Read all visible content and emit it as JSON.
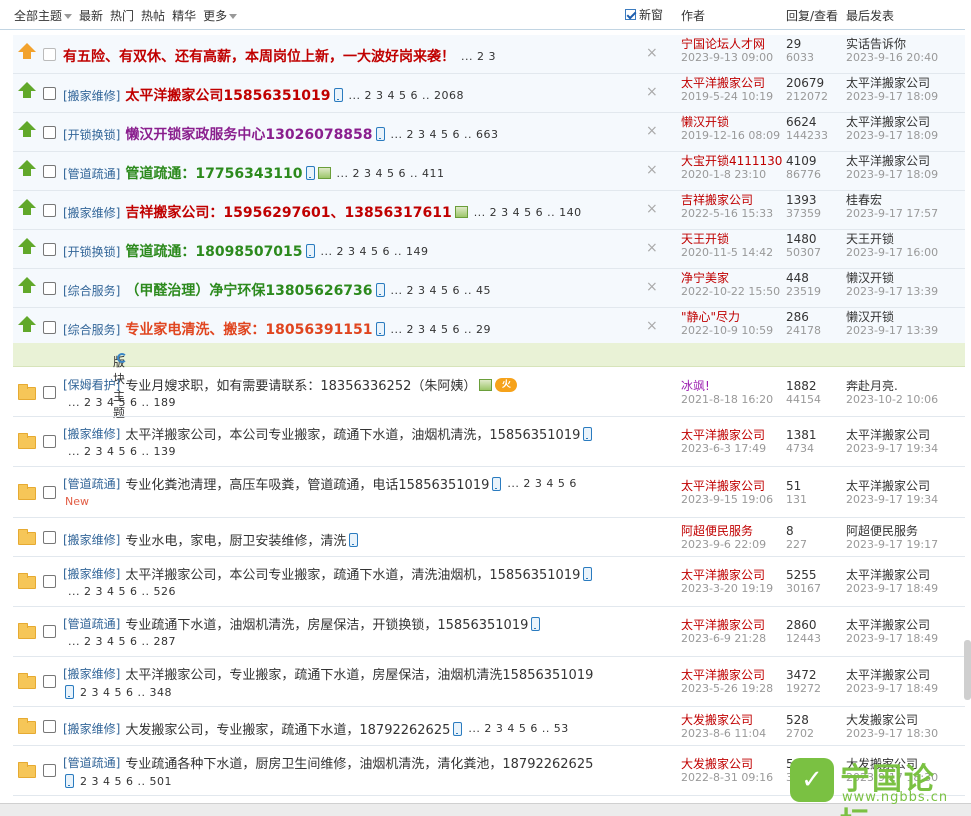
{
  "header": {
    "filters": [
      "全部主题",
      "最新",
      "热门",
      "热帖",
      "精华",
      "更多"
    ],
    "newwin_label": "新窗",
    "col_author": "作者",
    "col_reply": "回复/查看",
    "col_last": "最后发表"
  },
  "sticky": [
    {
      "tag": "",
      "title": "有五险、有双休、还有高薪，本周岗位上新，一大波好岗来袭！",
      "title_color": "#c00000",
      "pages": "... 2  3",
      "author": "宁国论坛人才网",
      "author_color": "#c00000",
      "date": "2023-9-13 09:00",
      "replies": "29",
      "views": "6033",
      "last_user": "实话告诉你",
      "last_date": "2023-9-16 20:40"
    },
    {
      "tag": "[搬家维修]",
      "title": "太平洋搬家公司15856351019",
      "title_color": "#c00000",
      "pages": "... 2  3  4  5  6 .. 2068",
      "author": "太平洋搬家公司",
      "author_color": "#c00000",
      "date": "2019-5-24 10:19",
      "replies": "20679",
      "views": "212072",
      "last_user": "太平洋搬家公司",
      "last_date": "2023-9-17 18:09"
    },
    {
      "tag": "[开锁换锁]",
      "title": "懒汉开锁家政服务中心13026078858",
      "title_color": "#8a1f8e",
      "pages": "... 2  3  4  5  6 .. 663",
      "author": "懒汉开锁",
      "author_color": "#c00000",
      "date": "2019-12-16 08:09",
      "replies": "6624",
      "views": "144233",
      "last_user": "太平洋搬家公司",
      "last_date": "2023-9-17 18:09"
    },
    {
      "tag": "[管道疏通]",
      "title": "管道疏通：17756343110",
      "title_color": "#2c8a1d",
      "pages": "... 2  3  4  5  6 .. 411",
      "author": "大宝开锁4111130",
      "author_color": "#c00000",
      "date": "2020-1-8 23:10",
      "replies": "4109",
      "views": "86776",
      "last_user": "太平洋搬家公司",
      "last_date": "2023-9-17 18:09"
    },
    {
      "tag": "[搬家维修]",
      "title": "吉祥搬家公司：15956297601、13856317611",
      "title_color": "#c00000",
      "pages": "... 2  3  4  5  6 .. 140",
      "author": "吉祥搬家公司",
      "author_color": "#c00000",
      "date": "2022-5-16 15:33",
      "replies": "1393",
      "views": "37359",
      "last_user": "桂春宏",
      "last_date": "2023-9-17 17:57"
    },
    {
      "tag": "[开锁换锁]",
      "title": "管道疏通：18098507015",
      "title_color": "#2c8a1d",
      "pages": "... 2  3  4  5  6 .. 149",
      "author": "天王开锁",
      "author_color": "#c00000",
      "date": "2020-11-5 14:42",
      "replies": "1480",
      "views": "50307",
      "last_user": "天王开锁",
      "last_date": "2023-9-17 16:00"
    },
    {
      "tag": "[综合服务]",
      "title": "（甲醛治理）净宁环保13805626736",
      "title_color": "#2c8a1d",
      "pages": "... 2  3  4  5  6 .. 45",
      "author": "净宁美家",
      "author_color": "#c00000",
      "date": "2022-10-22 15:50",
      "replies": "448",
      "views": "23519",
      "last_user": "懒汉开锁",
      "last_date": "2023-9-17 13:39"
    },
    {
      "tag": "[综合服务]",
      "title": "专业家电清洗、搬家：18056391151",
      "title_color": "#e0451f",
      "pages": "... 2  3  4  5  6 .. 29",
      "author": "\"静心\"尽力",
      "author_color": "#c00000",
      "date": "2022-10-9 10:59",
      "replies": "286",
      "views": "24178",
      "last_user": "懒汉开锁",
      "last_date": "2023-9-17 13:39"
    }
  ],
  "section_label": "版块主题",
  "threads": [
    {
      "tag": "[保姆看护]",
      "title": "专业月嫂求职，如有需要请联系：18356336252（朱阿姨）",
      "pages": "... 2  3  4  5  6 .. 189",
      "author": "冰飒!",
      "author_color": "#9b1fb0",
      "date": "2021-8-18 16:20",
      "replies": "1882",
      "views": "44154",
      "last_user": "奔赴月亮.",
      "last_date": "2023-10-2 10:06"
    },
    {
      "tag": "[搬家维修]",
      "title": "太平洋搬家公司，本公司专业搬家，疏通下水道，油烟机清洗，15856351019",
      "pages": "... 2  3  4  5  6 .. 139",
      "author": "太平洋搬家公司",
      "author_color": "#c00000",
      "date": "2023-6-3 17:49",
      "replies": "1381",
      "views": "4734",
      "last_user": "太平洋搬家公司",
      "last_date": "2023-9-17 19:34"
    },
    {
      "tag": "[管道疏通]",
      "title": "专业化粪池清理，高压车吸粪，管道疏通，电话15856351019",
      "pages": "... 2  3  4  5  6",
      "new": "New",
      "author": "太平洋搬家公司",
      "author_color": "#c00000",
      "date": "2023-9-15 19:06",
      "replies": "51",
      "views": "131",
      "last_user": "太平洋搬家公司",
      "last_date": "2023-9-17 19:34"
    },
    {
      "tag": "[搬家维修]",
      "title": "专业水电，家电，厨卫安装维修，清洗",
      "pages": "",
      "author": "阿超便民服务",
      "author_color": "#c00000",
      "date": "2023-9-6 22:09",
      "replies": "8",
      "views": "227",
      "last_user": "阿超便民服务",
      "last_date": "2023-9-17 19:17"
    },
    {
      "tag": "[搬家维修]",
      "title": "太平洋搬家公司，本公司专业搬家，疏通下水道，清洗油烟机，15856351019",
      "pages": "... 2  3  4  5  6 .. 526",
      "author": "太平洋搬家公司",
      "author_color": "#c00000",
      "date": "2023-3-20 19:19",
      "replies": "5255",
      "views": "30167",
      "last_user": "太平洋搬家公司",
      "last_date": "2023-9-17 18:49"
    },
    {
      "tag": "[管道疏通]",
      "title": "专业疏通下水道，油烟机清洗，房屋保洁，开锁换锁，15856351019",
      "pages": "... 2  3  4  5  6 .. 287",
      "author": "太平洋搬家公司",
      "author_color": "#c00000",
      "date": "2023-6-9 21:28",
      "replies": "2860",
      "views": "12443",
      "last_user": "太平洋搬家公司",
      "last_date": "2023-9-17 18:49"
    },
    {
      "tag": "[搬家维修]",
      "title": "太平洋搬家公司，专业搬家，疏通下水道，房屋保洁，油烟机清洗15856351019",
      "pages": "2  3  4  5  6 .. 348",
      "author": "太平洋搬家公司",
      "author_color": "#c00000",
      "date": "2023-5-26 19:28",
      "replies": "3472",
      "views": "19272",
      "last_user": "太平洋搬家公司",
      "last_date": "2023-9-17 18:49"
    },
    {
      "tag": "[搬家维修]",
      "title": "大发搬家公司，专业搬家，疏通下水道，18792262625",
      "pages": "... 2  3  4  5  6 .. 53",
      "author": "大发搬家公司",
      "author_color": "#c00000",
      "date": "2023-8-6 11:04",
      "replies": "528",
      "views": "2702",
      "last_user": "大发搬家公司",
      "last_date": "2023-9-17 18:30"
    },
    {
      "tag": "[管道疏通]",
      "title": "专业疏通各种下水道，厨房卫生间维修，油烟机清洗，清化粪池，18792262625",
      "pages": "2  3  4  5  6 .. 501",
      "author": "大发搬家公司",
      "author_color": "#c00000",
      "date": "2022-8-31 09:16",
      "replies": "5009",
      "views": "3",
      "last_user": "大发搬家公司",
      "last_date": "2023-9-17 18:30"
    }
  ],
  "watermark": {
    "title": "宁国论坛",
    "url": "www.ngbbs.cn"
  }
}
